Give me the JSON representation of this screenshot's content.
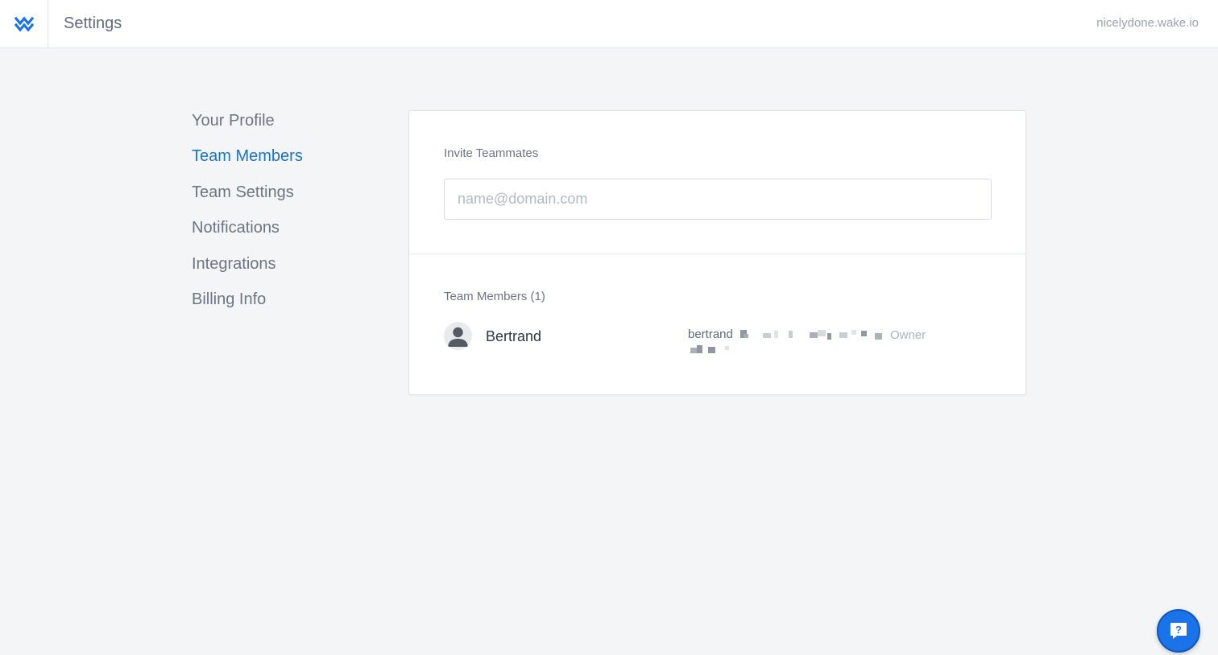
{
  "header": {
    "logo": "wake-logo-icon",
    "title": "Settings",
    "domain": "nicelydone.wake.io"
  },
  "sidebar": {
    "items": [
      {
        "label": "Your Profile",
        "active": false
      },
      {
        "label": "Team Members",
        "active": true
      },
      {
        "label": "Team Settings",
        "active": false
      },
      {
        "label": "Notifications",
        "active": false
      },
      {
        "label": "Integrations",
        "active": false
      },
      {
        "label": "Billing Info",
        "active": false
      }
    ]
  },
  "invite": {
    "label": "Invite Teammates",
    "placeholder": "name@domain.com",
    "value": ""
  },
  "members": {
    "label": "Team Members (1)",
    "list": [
      {
        "name": "Bertrand",
        "email": "bertrand",
        "role": "Owner"
      }
    ]
  },
  "help": {
    "icon": "help-chat-icon"
  },
  "colors": {
    "accent": "#1a73c9",
    "help_button": "#1a73e8",
    "background": "#f4f5f7"
  }
}
